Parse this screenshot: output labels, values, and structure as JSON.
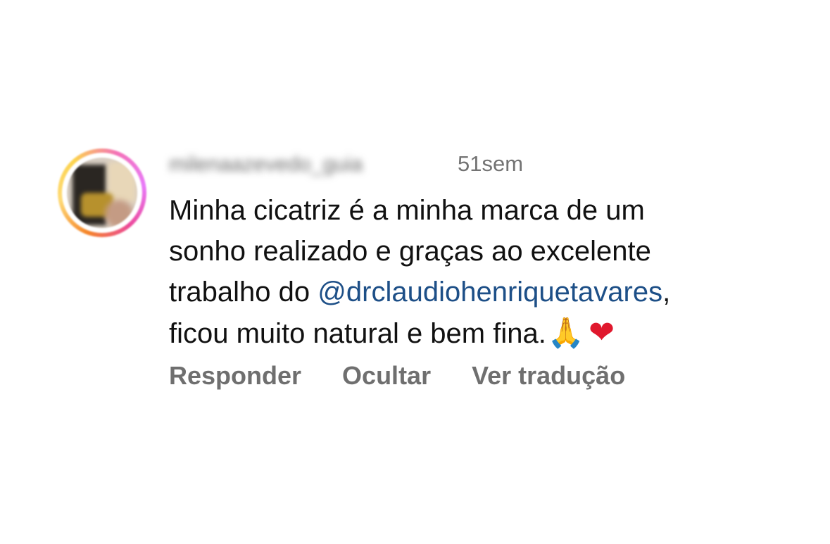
{
  "comment": {
    "username": "milenaazevedo_guia",
    "time": "51sem",
    "lines": {
      "l1": "Minha cicatriz é a minha marca de um",
      "l2": "sonho realizado e graças ao excelente",
      "l3_prefix": "trabalho do ",
      "l3_mention": "@drclaudiohenriquetavares",
      "l3_suffix": ",",
      "l4": "ficou muito natural e bem fina."
    },
    "emojis": {
      "pray": "🙏",
      "heart": "❤"
    }
  },
  "actions": {
    "reply": "Responder",
    "hide": "Ocultar",
    "translate": "Ver tradução"
  },
  "colors": {
    "mention": "#1d4f87",
    "secondary_text": "#737373",
    "primary_text": "#111111"
  }
}
